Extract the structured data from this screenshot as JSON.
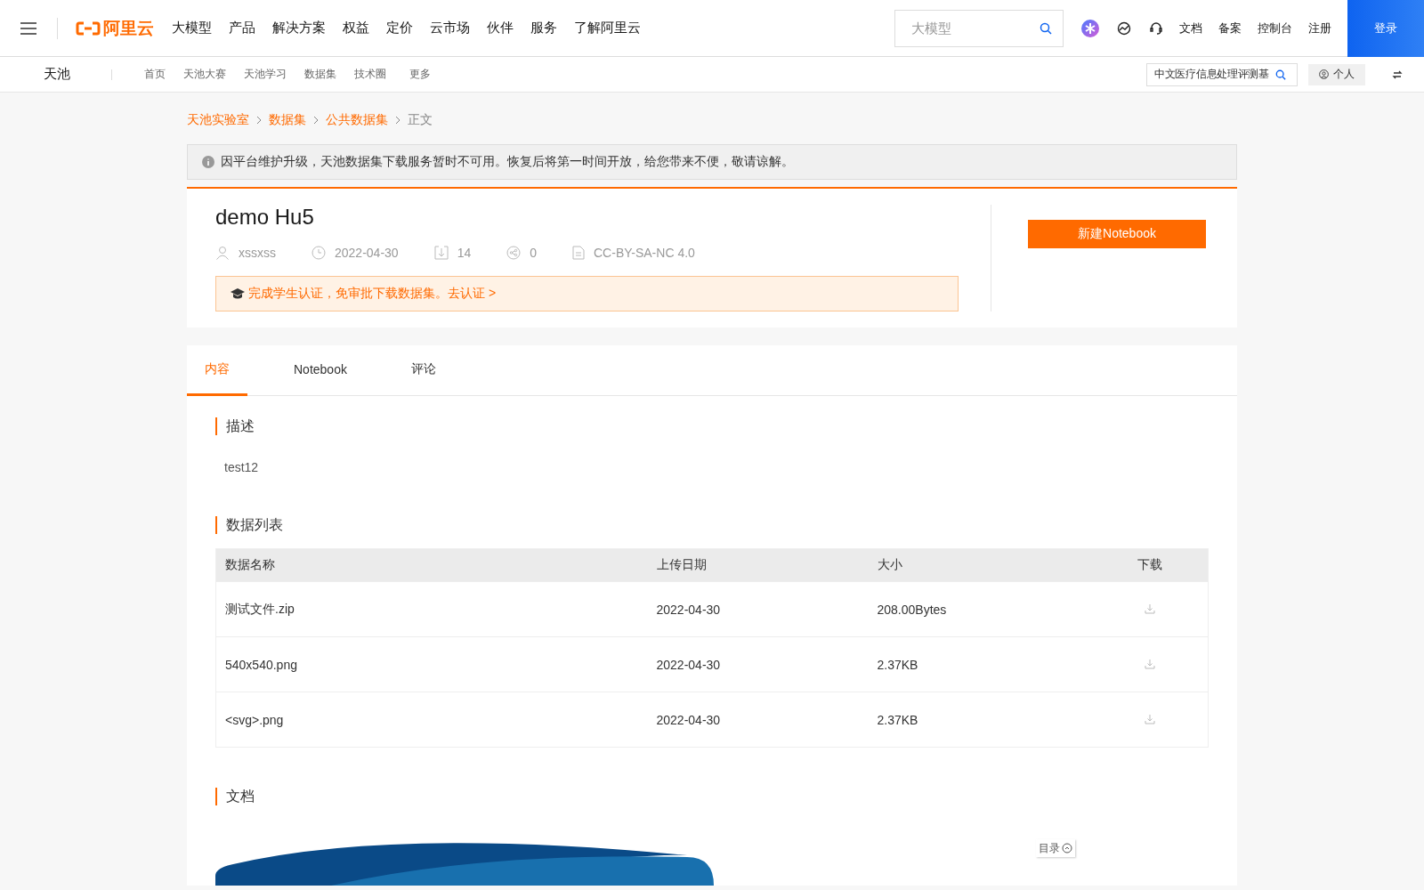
{
  "topbar": {
    "logo": "阿里云",
    "nav": [
      "大模型",
      "产品",
      "解决方案",
      "权益",
      "定价",
      "云市场",
      "伙伴",
      "服务",
      "了解阿里云"
    ],
    "search": {
      "placeholder": "大模型"
    },
    "links": [
      "文档",
      "备案",
      "控制台",
      "注册"
    ],
    "login": "登录"
  },
  "subnav": {
    "brand": "天池",
    "items": [
      "首页",
      "天池大赛",
      "天池学习",
      "数据集",
      "技术圈",
      "更多"
    ],
    "search": {
      "value": "中文医疗信息处理评测基"
    },
    "personal": "个人"
  },
  "breadcrumb": [
    {
      "label": "天池实验室",
      "link": true
    },
    {
      "label": "数据集",
      "link": true
    },
    {
      "label": "公共数据集",
      "link": true
    },
    {
      "label": "正文",
      "link": false
    }
  ],
  "notice": "因平台维护升级，天池数据集下载服务暂时不可用。恢复后将第一时间开放，给您带来不便，敬请谅解。",
  "dataset": {
    "title": "demo Hu5",
    "author": "xssxss",
    "date": "2022-04-30",
    "downloads": "14",
    "shares": "0",
    "license": "CC-BY-SA-NC 4.0",
    "student_tip": "完成学生认证，免审批下载数据集。去认证 >",
    "new_notebook": "新建Notebook"
  },
  "tabs": [
    {
      "label": "内容",
      "selected": true
    },
    {
      "label": "Notebook",
      "selected": false
    },
    {
      "label": "评论",
      "selected": false
    }
  ],
  "description": {
    "heading": "描述",
    "text": "test12"
  },
  "files": {
    "heading": "数据列表",
    "columns": [
      "数据名称",
      "上传日期",
      "大小",
      "下载"
    ],
    "rows": [
      {
        "name": "测试文件.zip",
        "date": "2022-04-30",
        "size": "208.00Bytes"
      },
      {
        "name": "540x540.png",
        "date": "2022-04-30",
        "size": "2.37KB"
      },
      {
        "name": "<svg>.png",
        "date": "2022-04-30",
        "size": "2.37KB"
      }
    ]
  },
  "docs": {
    "heading": "文档",
    "toc": "目录"
  }
}
